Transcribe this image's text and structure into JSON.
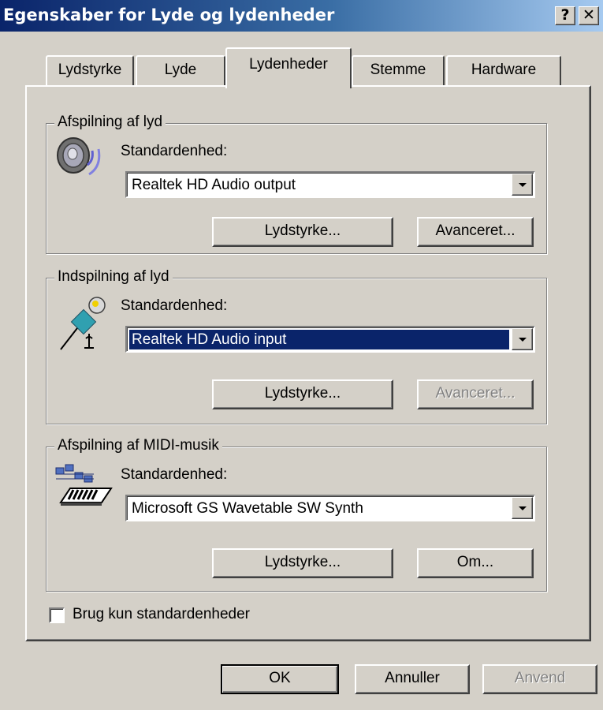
{
  "window": {
    "title": "Egenskaber for Lyde og lydenheder",
    "help_label": "?",
    "close_label": "✕"
  },
  "tabs": [
    {
      "label": "Lydstyrke"
    },
    {
      "label": "Lyde"
    },
    {
      "label": "Lydenheder",
      "active": true
    },
    {
      "label": "Stemme"
    },
    {
      "label": "Hardware"
    }
  ],
  "playback": {
    "group_label": "Afspilning af lyd",
    "standard_label": "Standardenhed:",
    "device": "Realtek HD Audio output",
    "volume_button": "Lydstyrke...",
    "advanced_button": "Avanceret...",
    "icon": "speaker-icon"
  },
  "recording": {
    "group_label": "Indspilning af lyd",
    "standard_label": "Standardenhed:",
    "device": "Realtek HD Audio input",
    "volume_button": "Lydstyrke...",
    "advanced_button": "Avanceret...",
    "icon": "microphone-icon"
  },
  "midi": {
    "group_label": "Afspilning af MIDI-musik",
    "standard_label": "Standardenhed:",
    "device": "Microsoft GS Wavetable SW Synth",
    "volume_button": "Lydstyrke...",
    "about_button": "Om...",
    "icon": "midi-keyboard-icon"
  },
  "only_default_devices": {
    "label": "Brug kun standardenheder",
    "checked": false
  },
  "footer": {
    "ok": "OK",
    "cancel": "Annuller",
    "apply": "Anvend"
  },
  "colors": {
    "face": "#d4d0c8",
    "title_start": "#0a246a",
    "title_end": "#a6caf0",
    "selection": "#0a246a"
  }
}
